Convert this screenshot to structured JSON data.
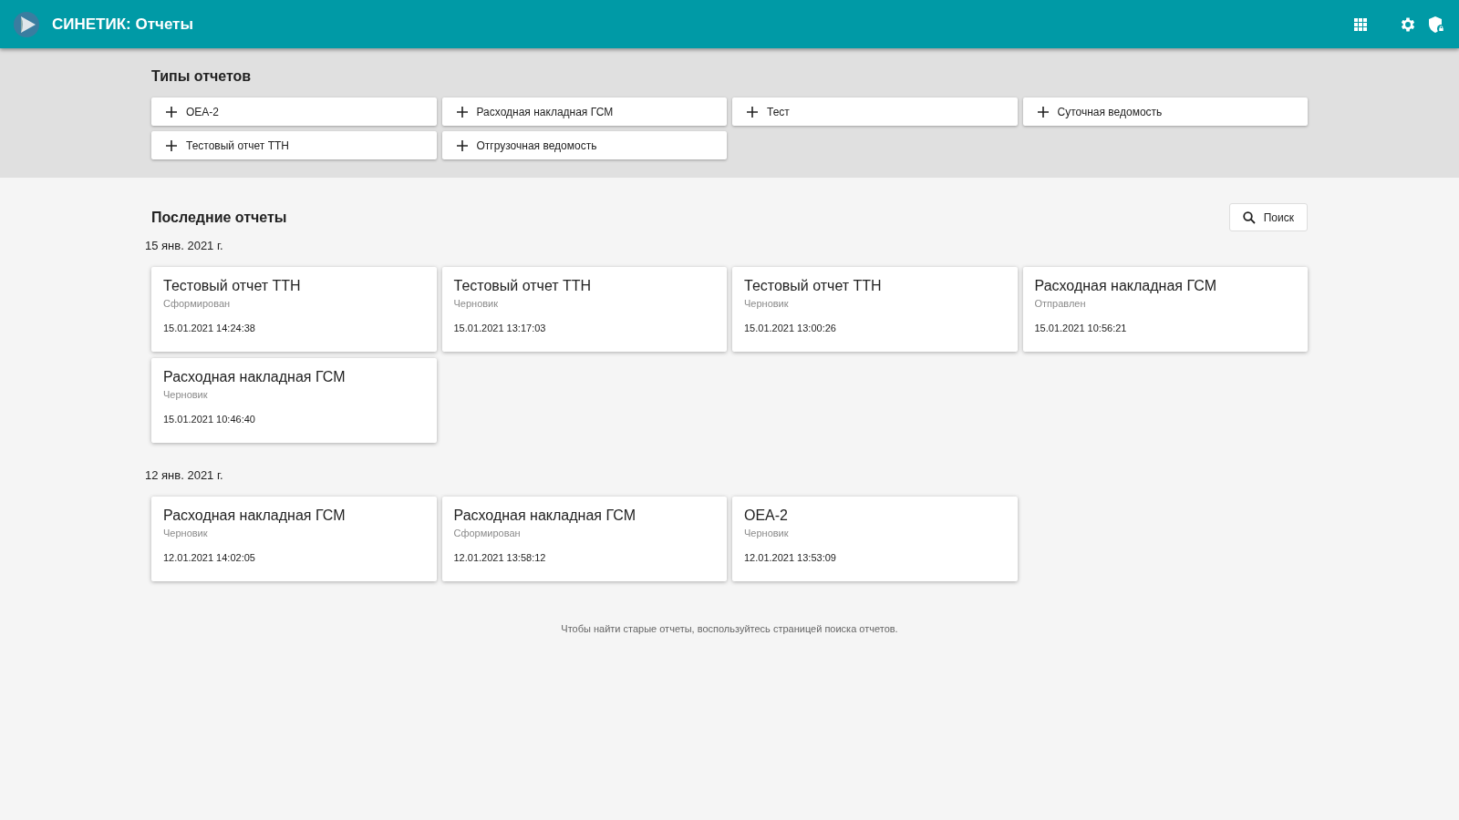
{
  "app_bar": {
    "title": "СИНЕТИК: Отчеты"
  },
  "report_types": {
    "title": "Типы отчетов",
    "items": [
      {
        "label": "OEA-2"
      },
      {
        "label": "Расходная накладная ГСМ"
      },
      {
        "label": "Тест"
      },
      {
        "label": "Суточная ведомость"
      },
      {
        "label": "Тестовый отчет ТТН"
      },
      {
        "label": "Отгрузочная ведомость"
      }
    ]
  },
  "recent": {
    "title": "Последние отчеты",
    "search_button": "Поиск",
    "groups": [
      {
        "date": "15 янв. 2021 г.",
        "reports": [
          {
            "title": "Тестовый отчет ТТН",
            "status": "Сформирован",
            "timestamp": "15.01.2021 14:24:38"
          },
          {
            "title": "Тестовый отчет ТТН",
            "status": "Черновик",
            "timestamp": "15.01.2021 13:17:03"
          },
          {
            "title": "Тестовый отчет ТТН",
            "status": "Черновик",
            "timestamp": "15.01.2021 13:00:26"
          },
          {
            "title": "Расходная накладная ГСМ",
            "status": "Отправлен",
            "timestamp": "15.01.2021 10:56:21"
          },
          {
            "title": "Расходная накладная ГСМ",
            "status": "Черновик",
            "timestamp": "15.01.2021 10:46:40"
          }
        ]
      },
      {
        "date": "12 янв. 2021 г.",
        "reports": [
          {
            "title": "Расходная накладная ГСМ",
            "status": "Черновик",
            "timestamp": "12.01.2021 14:02:05"
          },
          {
            "title": "Расходная накладная ГСМ",
            "status": "Сформирован",
            "timestamp": "12.01.2021 13:58:12"
          },
          {
            "title": "OEA-2",
            "status": "Черновик",
            "timestamp": "12.01.2021 13:53:09"
          }
        ]
      }
    ]
  },
  "footer_note": "Чтобы найти старые отчеты, воспользуйтесь страницей поиска отчетов."
}
